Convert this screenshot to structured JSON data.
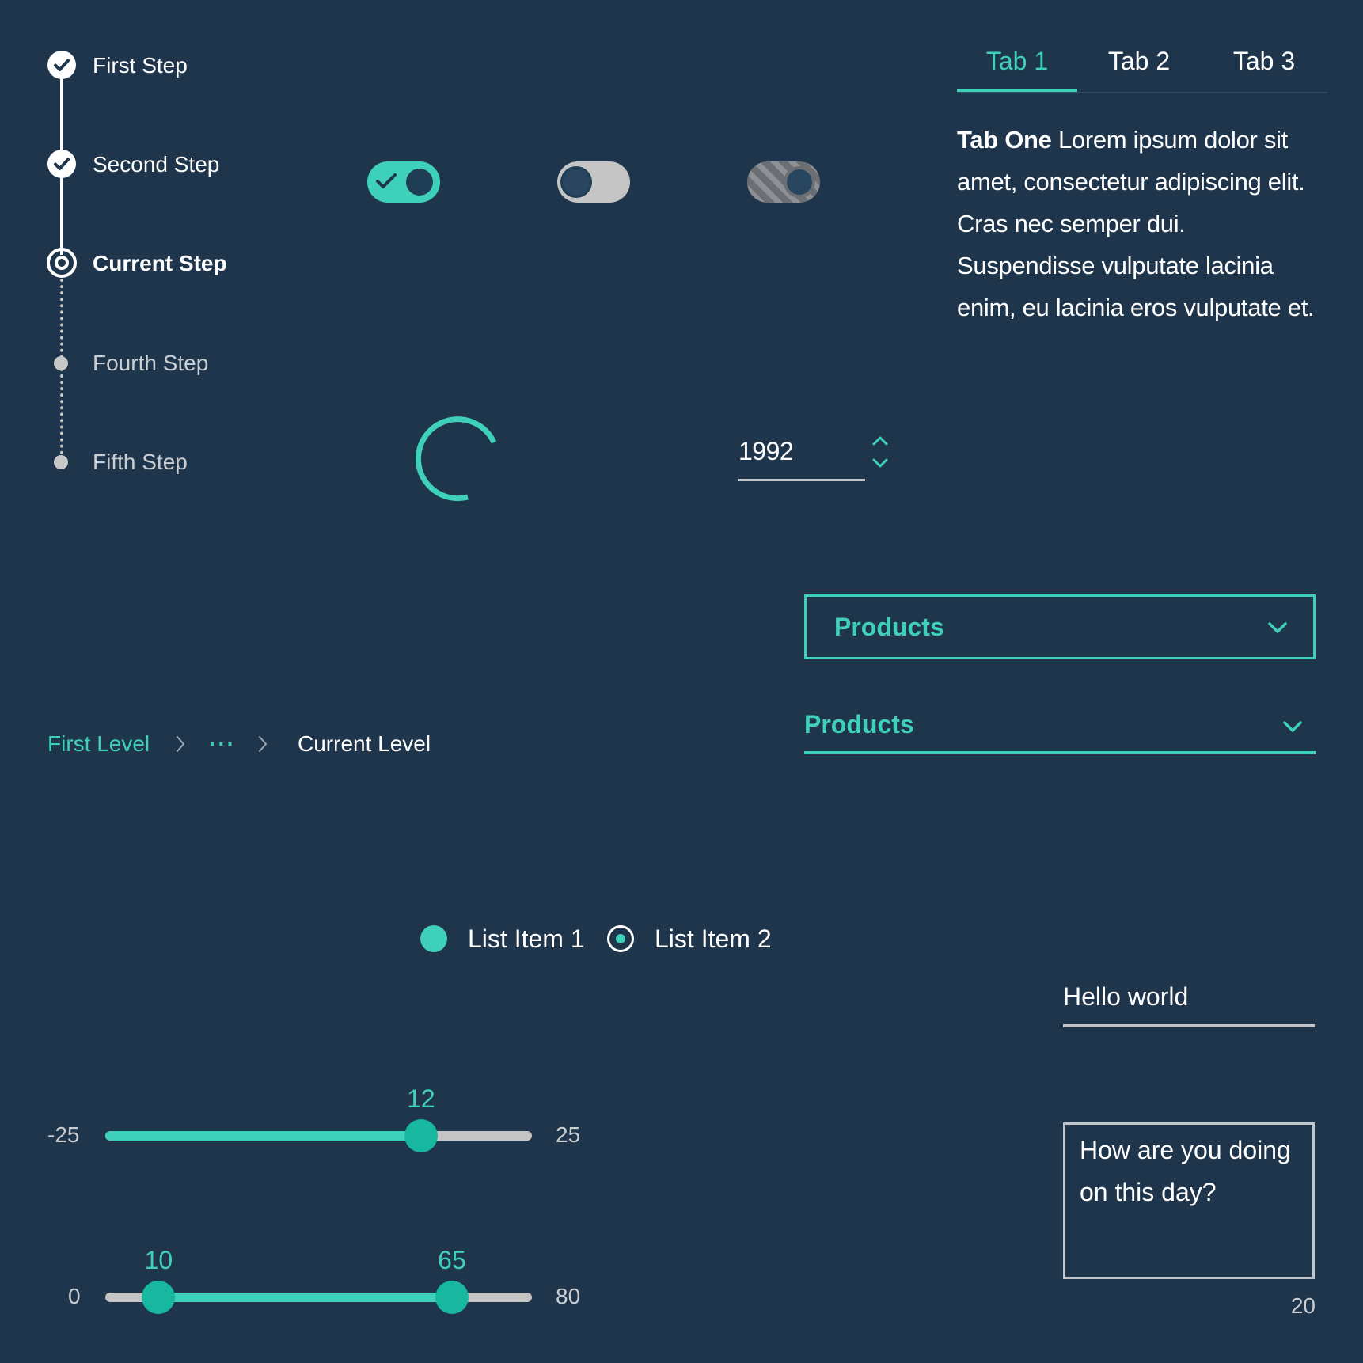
{
  "colors": {
    "background": "#1f354b",
    "accent": "#3ed0b9",
    "muted": "#c5c5c5",
    "text": "#ffffff"
  },
  "progress": {
    "steps": [
      {
        "label": "First Step",
        "state": "complete"
      },
      {
        "label": "Second Step",
        "state": "complete"
      },
      {
        "label": "Current Step",
        "state": "current"
      },
      {
        "label": "Fourth Step",
        "state": "incomplete"
      },
      {
        "label": "Fifth Step",
        "state": "incomplete"
      }
    ]
  },
  "toggles": [
    {
      "state": "on"
    },
    {
      "state": "off"
    },
    {
      "state": "disabled-on"
    }
  ],
  "tabs": {
    "items": [
      {
        "label": "Tab 1",
        "active": true
      },
      {
        "label": "Tab 2",
        "active": false
      },
      {
        "label": "Tab 3",
        "active": false
      }
    ],
    "content_title": "Tab One",
    "content_body": "Lorem ipsum dolor sit amet, consectetur adipiscing elit. Cras nec semper dui. Suspendisse vulputate lacinia enim, eu lacinia eros vulputate et."
  },
  "number_input": {
    "value": "1992"
  },
  "select_boxed": {
    "label": "Products"
  },
  "select_inline": {
    "label": "Products"
  },
  "breadcrumb": {
    "first": "First Level",
    "ellipsis": "···",
    "current": "Current Level"
  },
  "radios": [
    {
      "label": "List Item 1",
      "selected": true
    },
    {
      "label": "List Item 2",
      "selected": false
    }
  ],
  "text_input": {
    "value": "Hello world"
  },
  "textarea": {
    "value": "How are you doing on this day?",
    "counter": "20"
  },
  "slider_single": {
    "min": "-25",
    "max": "25",
    "value": "12"
  },
  "slider_range": {
    "min": "0",
    "max": "80",
    "low": "10",
    "high": "65"
  }
}
